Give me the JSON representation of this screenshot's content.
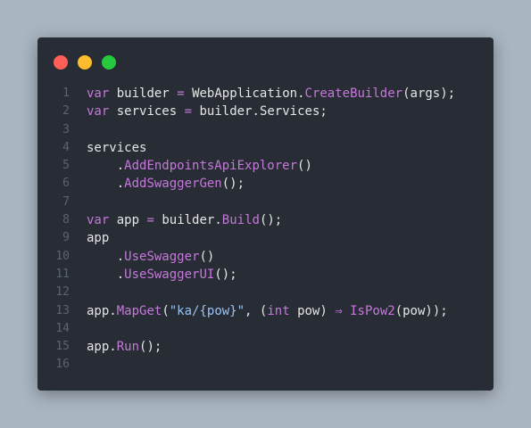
{
  "colors": {
    "background": "#a9b5c1",
    "window": "#282c34",
    "close": "#ff5f56",
    "minimize": "#ffbd2e",
    "maximize": "#27c93f",
    "line_number": "#5c6370",
    "keyword": "#c678dd",
    "text": "#e6e6e6",
    "string": "#98c3f5"
  },
  "window": {
    "buttons": [
      "close-button",
      "minimize-button",
      "maximize-button"
    ]
  },
  "code": {
    "lines": [
      {
        "n": "1",
        "tokens": [
          [
            "kw",
            "var"
          ],
          [
            "sp",
            " "
          ],
          [
            "ident",
            "builder"
          ],
          [
            "sp",
            " "
          ],
          [
            "op",
            "="
          ],
          [
            "sp",
            " "
          ],
          [
            "ident",
            "WebApplication"
          ],
          [
            "punct",
            "."
          ],
          [
            "method",
            "CreateBuilder"
          ],
          [
            "punct",
            "(args);"
          ]
        ]
      },
      {
        "n": "2",
        "tokens": [
          [
            "kw",
            "var"
          ],
          [
            "sp",
            " "
          ],
          [
            "ident",
            "services"
          ],
          [
            "sp",
            " "
          ],
          [
            "op",
            "="
          ],
          [
            "sp",
            " "
          ],
          [
            "ident",
            "builder"
          ],
          [
            "punct",
            "."
          ],
          [
            "ident",
            "Services"
          ],
          [
            "punct",
            ";"
          ]
        ]
      },
      {
        "n": "3",
        "tokens": []
      },
      {
        "n": "4",
        "tokens": [
          [
            "ident",
            "services"
          ]
        ]
      },
      {
        "n": "5",
        "tokens": [
          [
            "sp",
            "    "
          ],
          [
            "punct",
            "."
          ],
          [
            "method",
            "AddEndpointsApiExplorer"
          ],
          [
            "punct",
            "()"
          ]
        ]
      },
      {
        "n": "6",
        "tokens": [
          [
            "sp",
            "    "
          ],
          [
            "punct",
            "."
          ],
          [
            "method",
            "AddSwaggerGen"
          ],
          [
            "punct",
            "();"
          ]
        ]
      },
      {
        "n": "7",
        "tokens": []
      },
      {
        "n": "8",
        "tokens": [
          [
            "kw",
            "var"
          ],
          [
            "sp",
            " "
          ],
          [
            "ident",
            "app"
          ],
          [
            "sp",
            " "
          ],
          [
            "op",
            "="
          ],
          [
            "sp",
            " "
          ],
          [
            "ident",
            "builder"
          ],
          [
            "punct",
            "."
          ],
          [
            "method",
            "Build"
          ],
          [
            "punct",
            "();"
          ]
        ]
      },
      {
        "n": "9",
        "tokens": [
          [
            "ident",
            "app"
          ]
        ]
      },
      {
        "n": "10",
        "tokens": [
          [
            "sp",
            "    "
          ],
          [
            "punct",
            "."
          ],
          [
            "method",
            "UseSwagger"
          ],
          [
            "punct",
            "()"
          ]
        ]
      },
      {
        "n": "11",
        "tokens": [
          [
            "sp",
            "    "
          ],
          [
            "punct",
            "."
          ],
          [
            "method",
            "UseSwaggerUI"
          ],
          [
            "punct",
            "();"
          ]
        ]
      },
      {
        "n": "12",
        "tokens": []
      },
      {
        "n": "13",
        "tokens": [
          [
            "ident",
            "app"
          ],
          [
            "punct",
            "."
          ],
          [
            "method",
            "MapGet"
          ],
          [
            "punct",
            "("
          ],
          [
            "str",
            "\"ka/{pow}\""
          ],
          [
            "punct",
            ", ("
          ],
          [
            "kw",
            "int"
          ],
          [
            "sp",
            " "
          ],
          [
            "ident",
            "pow"
          ],
          [
            "punct",
            ") "
          ],
          [
            "op",
            "⇒"
          ],
          [
            "sp",
            " "
          ],
          [
            "method",
            "IsPow2"
          ],
          [
            "punct",
            "(pow));"
          ]
        ]
      },
      {
        "n": "14",
        "tokens": []
      },
      {
        "n": "15",
        "tokens": [
          [
            "ident",
            "app"
          ],
          [
            "punct",
            "."
          ],
          [
            "method",
            "Run"
          ],
          [
            "punct",
            "();"
          ]
        ]
      },
      {
        "n": "16",
        "tokens": []
      }
    ]
  }
}
